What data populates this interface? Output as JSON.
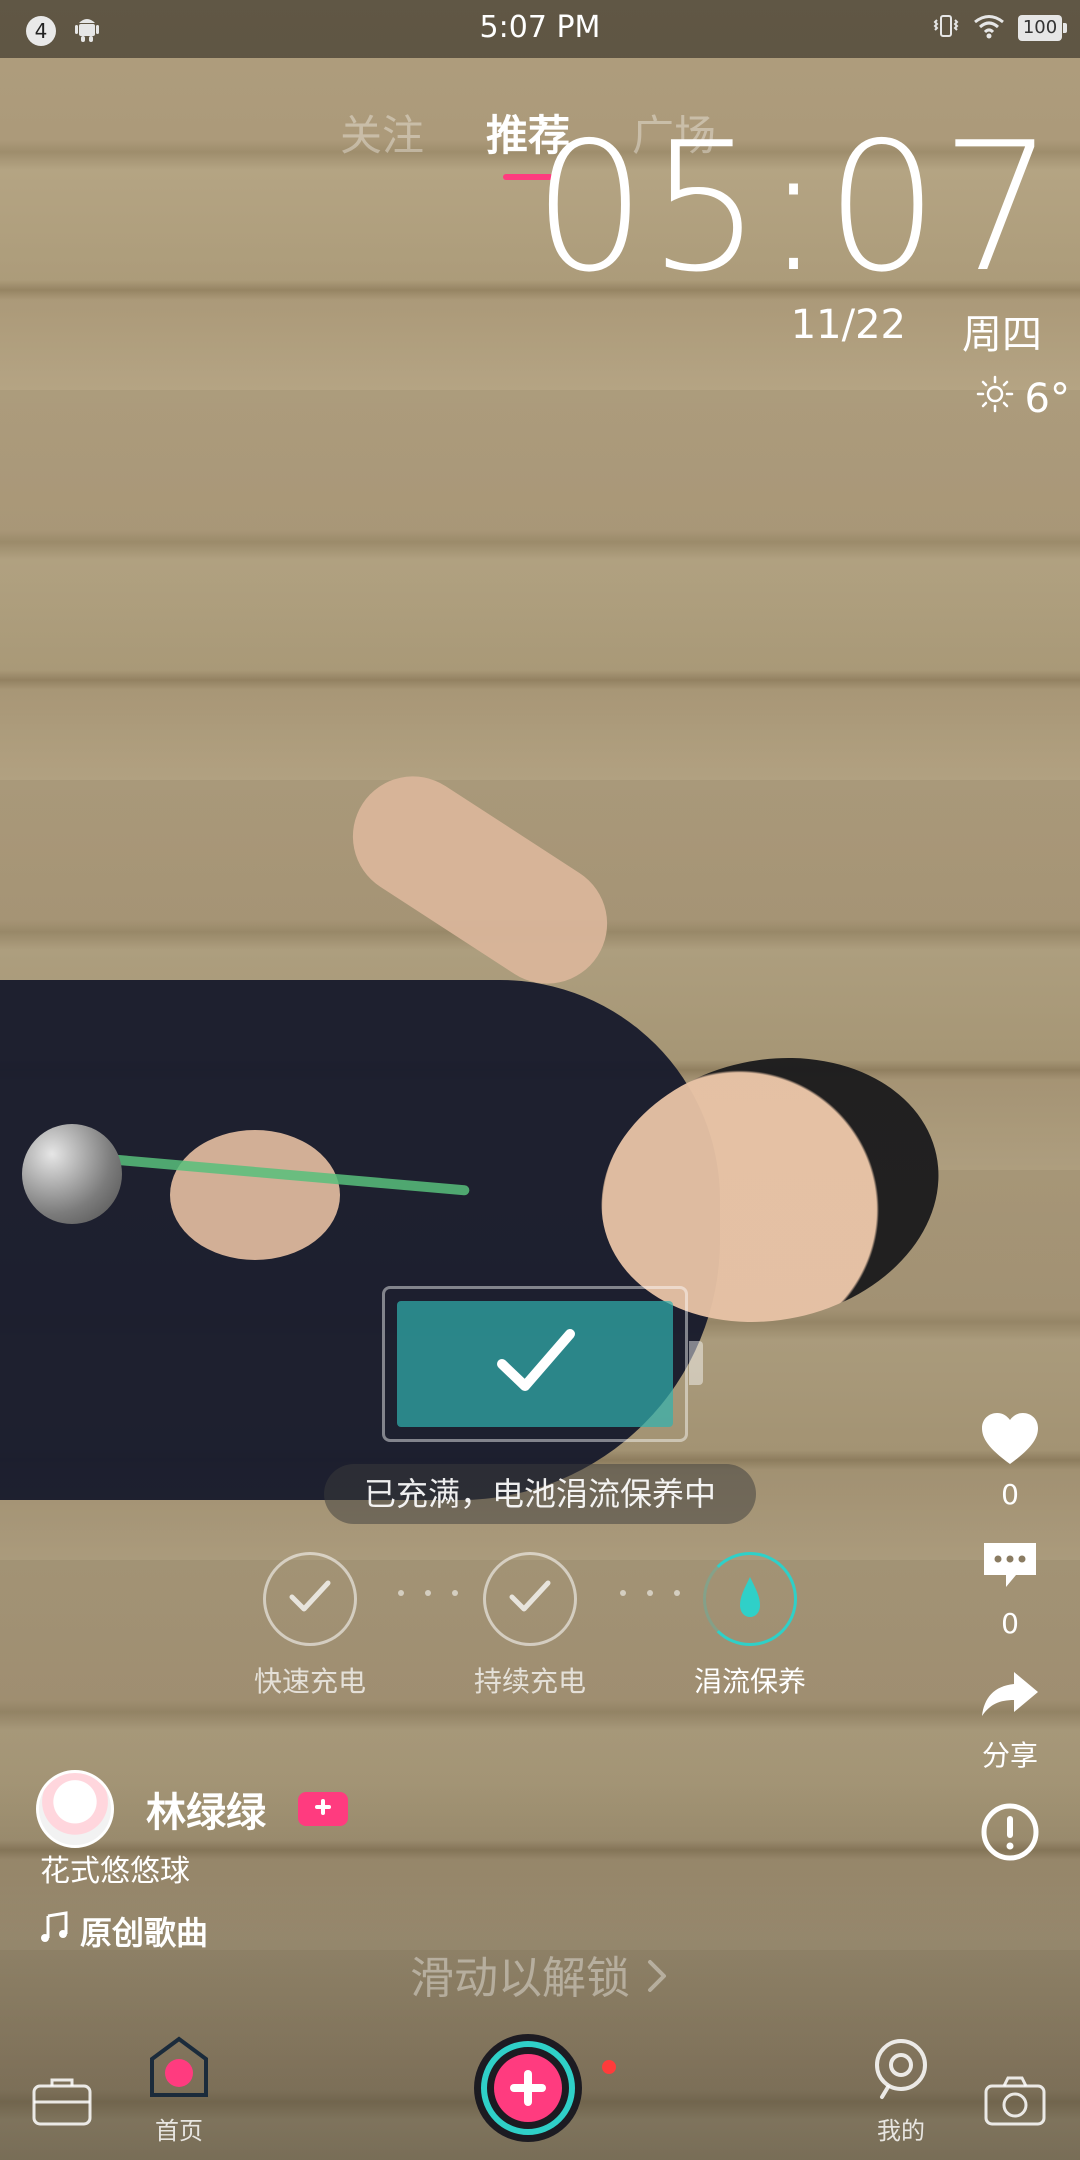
{
  "status_bar": {
    "notification_count": "4",
    "time": "5:07 PM",
    "battery": "100"
  },
  "tabs": [
    {
      "label": "关注"
    },
    {
      "label": "推荐"
    },
    {
      "label": "广场"
    }
  ],
  "lock_screen": {
    "clock": "05:07",
    "date": "11/22",
    "weekday": "周四",
    "temperature": "6°",
    "charge_status": "已充满，电池涓流保养中",
    "stages": [
      {
        "label": "快速充电"
      },
      {
        "label": "持续充电"
      },
      {
        "label": "涓流保养"
      }
    ],
    "unlock_hint": "滑动以解锁"
  },
  "side_actions": {
    "likes": "0",
    "comments": "0",
    "share_label": "分享"
  },
  "post": {
    "author": "林绿绿",
    "description": "花式悠悠球",
    "music": "原创歌曲"
  },
  "bottom_nav": {
    "home": "首页",
    "me": "我的"
  },
  "colors": {
    "accent_pink": "#ff3b7f",
    "teal": "#2fd0c8"
  }
}
